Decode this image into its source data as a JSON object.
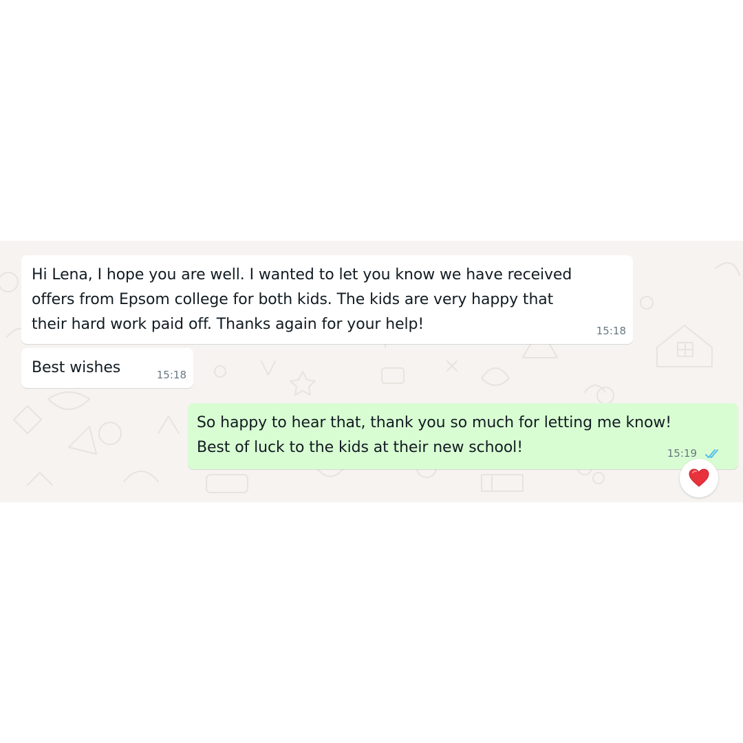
{
  "conversation": {
    "messages": [
      {
        "direction": "incoming",
        "text": "Hi Lena, I hope you are well. I wanted to let you know we have received\noffers from Epsom college for both kids. The kids are very happy that\ntheir hard work paid off. Thanks again for your help!",
        "time": "15:18"
      },
      {
        "direction": "incoming",
        "text": "Best wishes",
        "time": "15:18"
      },
      {
        "direction": "outgoing",
        "text": "So happy to hear that, thank you so much for letting me know!\nBest of luck to the kids at their new school!",
        "time": "15:19",
        "status_icon": "double-check-read-icon",
        "reaction_icon": "red-heart-icon"
      }
    ]
  },
  "colors": {
    "wallpaper_bg": "#f6f3f1",
    "incoming_bubble": "#ffffff",
    "outgoing_bubble": "#d9fdd3",
    "read_ticks": "#53bdeb",
    "reaction_heart": "#e8323c"
  }
}
